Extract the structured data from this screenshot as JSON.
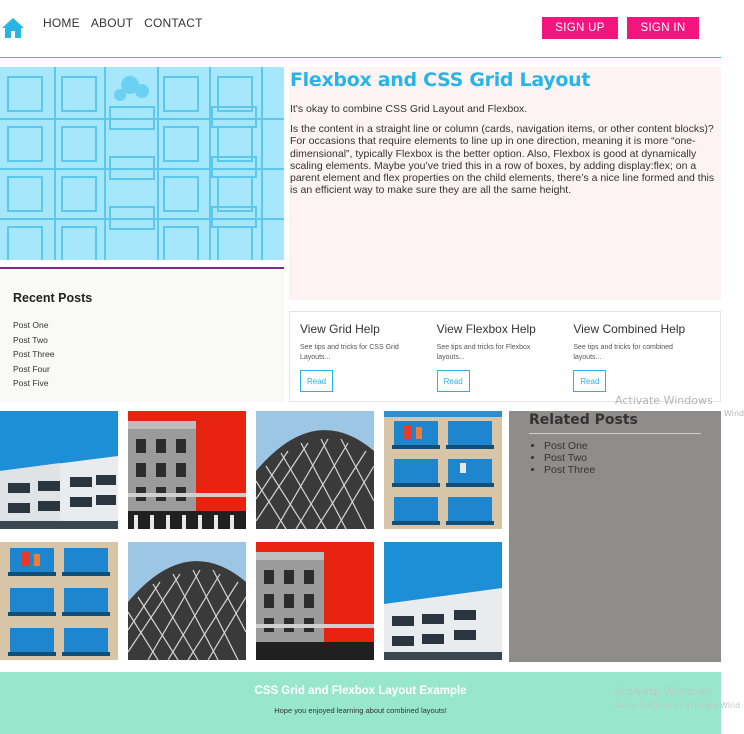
{
  "header": {
    "nav": [
      "HOME",
      "ABOUT",
      "CONTACT"
    ],
    "signup_label": "SIGN UP",
    "signin_label": "SIGN IN",
    "home_icon": "home-icon"
  },
  "article": {
    "title": "Flexbox and CSS Grid Layout",
    "intro": "It's okay to combine CSS Grid Layout and Flexbox.",
    "body": "Is the content in a straight line or column (cards, navigation items, or other content blocks)? For occasions that require elements to line up in one direction, meaning it is more “one-dimensional”, typically Flexbox is the better option. Also, Flexbox is good at dynamically scaling elements. Maybe you’ve tried this in a row of boxes, by adding display:flex; on a parent element and flex properties on the child elements, there’s a nice line formed and this is an efficient way to make sure they are all the same height."
  },
  "recent": {
    "title": "Recent Posts",
    "items": [
      "Post One",
      "Post Two",
      "Post Three",
      "Post Four",
      "Post Five"
    ]
  },
  "help": [
    {
      "title": "View Grid Help",
      "desc": "See tips and tricks for CSS Grid Layouts...",
      "button": "Read"
    },
    {
      "title": "View Flexbox Help",
      "desc": "See tips and tricks for Flexbox layouts...",
      "button": "Read"
    },
    {
      "title": "View Combined Help",
      "desc": "See tips and tricks for combined layouts...",
      "button": "Read"
    }
  ],
  "related": {
    "title": "Related Posts",
    "items": [
      "Post One",
      "Post Two",
      "Post Three"
    ]
  },
  "footer": {
    "title": "CSS Grid and Flexbox Layout Example",
    "subtitle": "Hope you enjoyed learning about combined layouts!"
  },
  "watermark": {
    "line1": "Activate Windows",
    "line1_edge": "Wind",
    "line2": "Activate Windows",
    "line3": "Go to Settings to activate Wind"
  },
  "colors": {
    "accent_blue": "#29b4e6",
    "pink": "#f2157d",
    "footer_green": "#98e7cd",
    "related_gray": "#8f8c8c"
  }
}
